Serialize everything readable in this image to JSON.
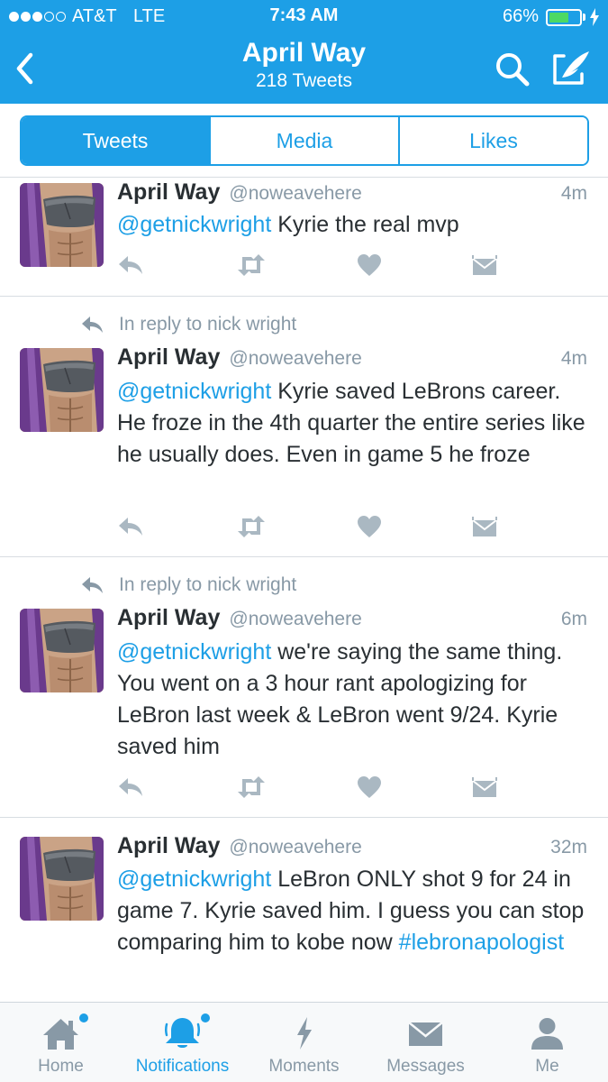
{
  "status_bar": {
    "carrier": "AT&T",
    "network": "LTE",
    "time": "7:43 AM",
    "battery_percent_label": "66%",
    "battery_level": 0.66,
    "signal_bars": 3
  },
  "nav": {
    "title": "April Way",
    "subtitle": "218 Tweets",
    "back_icon": "chevron-left-icon",
    "search_icon": "search-icon",
    "compose_icon": "compose-icon"
  },
  "tabs": [
    {
      "label": "Tweets",
      "active": true
    },
    {
      "label": "Media",
      "active": false
    },
    {
      "label": "Likes",
      "active": false
    }
  ],
  "tweets": [
    {
      "name": "April Way",
      "handle": "@noweavehere",
      "time": "4m",
      "reply_context": "",
      "mention": "@getnickwright",
      "text": " Kyrie the real mvp",
      "hashtag": ""
    },
    {
      "name": "April Way",
      "handle": "@noweavehere",
      "time": "4m",
      "reply_context": "In reply to nick wright",
      "mention": "@getnickwright",
      "text": " Kyrie saved LeBrons career. He froze in the 4th quarter the entire series like he usually does. Even in game 5 he froze",
      "hashtag": ""
    },
    {
      "name": "April Way",
      "handle": "@noweavehere",
      "time": "6m",
      "reply_context": "In reply to nick wright",
      "mention": "@getnickwright",
      "text": " we're saying the same thing. You went on a 3 hour rant apologizing for LeBron last week & LeBron went 9/24.  Kyrie saved him",
      "hashtag": ""
    },
    {
      "name": "April Way",
      "handle": "@noweavehere",
      "time": "32m",
      "reply_context": "",
      "mention": "@getnickwright",
      "text": " LeBron ONLY shot 9 for 24 in game 7. Kyrie saved him.  I guess you can stop comparing him to kobe now ",
      "hashtag": "#lebronapologist"
    }
  ],
  "tab_bar": [
    {
      "label": "Home",
      "icon": "home-icon",
      "active": false,
      "badge": true
    },
    {
      "label": "Notifications",
      "icon": "bell-icon",
      "active": true,
      "badge": true
    },
    {
      "label": "Moments",
      "icon": "lightning-icon",
      "active": false,
      "badge": false
    },
    {
      "label": "Messages",
      "icon": "envelope-icon",
      "active": false,
      "badge": false
    },
    {
      "label": "Me",
      "icon": "person-icon",
      "active": false,
      "badge": false
    }
  ],
  "colors": {
    "brand_blue": "#1d9fe6",
    "text_dark": "#292f33",
    "text_gray": "#8899a6",
    "action_gray": "#aab8c2",
    "battery_green": "#4cd964"
  }
}
